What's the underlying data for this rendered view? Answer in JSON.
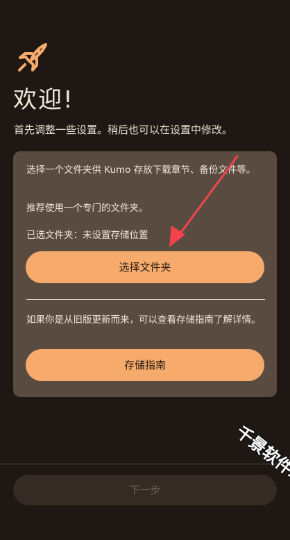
{
  "welcome": {
    "title": "欢迎!",
    "subtitle": "首先调整一些设置。稍后也可以在设置中修改。"
  },
  "storage": {
    "description": "选择一个文件夹供 Kumo 存放下载章节、备份文件等。",
    "recommendation": "推荐使用一个专门的文件夹。",
    "selected_label": "已选文件夹：",
    "selected_value": "未设置存储位置",
    "choose_folder_label": "选择文件夹",
    "legacy_hint": "如果你是从旧版更新而来，可以查看存储指南了解详情。",
    "guide_label": "存储指南"
  },
  "footer": {
    "next_label": "下一步"
  },
  "watermark": {
    "text": "千景软件站"
  },
  "colors": {
    "background": "#1f1713",
    "card": "#5a4b41",
    "accent": "#f6ab6c",
    "annotation": "#f2444a"
  },
  "icons": {
    "logo": "rocket-icon",
    "annotation": "red-arrow-annotation"
  }
}
